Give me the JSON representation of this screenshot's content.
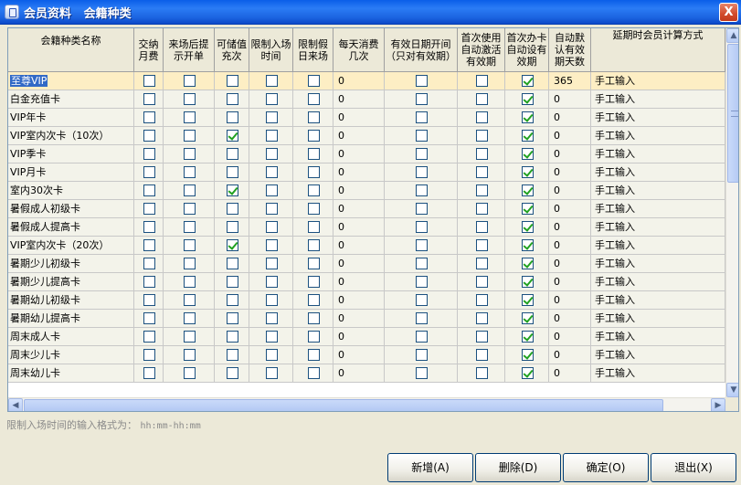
{
  "window": {
    "title": "会员资料   会籍种类",
    "close_label": "X"
  },
  "columns": [
    "会籍种类名称",
    "交纳月费",
    "来场后提示开单",
    "可储值充次",
    "限制入场时间",
    "限制假日来场",
    "每天消费几次",
    "有效日期开间（只对有效期）",
    "首次使用自动激活有效期",
    "首次办卡自动设有效期",
    "自动默认有效期天数",
    "延期时会员计算方式"
  ],
  "rows": [
    {
      "name": "至尊VIP",
      "flags": [
        false,
        false,
        false,
        false,
        false
      ],
      "times": "0",
      "d1": false,
      "d2": false,
      "d3": true,
      "days": "365",
      "ext": "手工输入"
    },
    {
      "name": "白金充值卡",
      "flags": [
        false,
        false,
        false,
        false,
        false
      ],
      "times": "0",
      "d1": false,
      "d2": false,
      "d3": true,
      "days": "0",
      "ext": "手工输入"
    },
    {
      "name": "VIP年卡",
      "flags": [
        false,
        false,
        false,
        false,
        false
      ],
      "times": "0",
      "d1": false,
      "d2": false,
      "d3": true,
      "days": "0",
      "ext": "手工输入"
    },
    {
      "name": "VIP室内次卡（10次）",
      "flags": [
        false,
        false,
        true,
        false,
        false
      ],
      "times": "0",
      "d1": false,
      "d2": false,
      "d3": true,
      "days": "0",
      "ext": "手工输入"
    },
    {
      "name": "VIP季卡",
      "flags": [
        false,
        false,
        false,
        false,
        false
      ],
      "times": "0",
      "d1": false,
      "d2": false,
      "d3": true,
      "days": "0",
      "ext": "手工输入"
    },
    {
      "name": "VIP月卡",
      "flags": [
        false,
        false,
        false,
        false,
        false
      ],
      "times": "0",
      "d1": false,
      "d2": false,
      "d3": true,
      "days": "0",
      "ext": "手工输入"
    },
    {
      "name": "室内30次卡",
      "flags": [
        false,
        false,
        true,
        false,
        false
      ],
      "times": "0",
      "d1": false,
      "d2": false,
      "d3": true,
      "days": "0",
      "ext": "手工输入"
    },
    {
      "name": "暑假成人初级卡",
      "flags": [
        false,
        false,
        false,
        false,
        false
      ],
      "times": "0",
      "d1": false,
      "d2": false,
      "d3": true,
      "days": "0",
      "ext": "手工输入"
    },
    {
      "name": "暑假成人提高卡",
      "flags": [
        false,
        false,
        false,
        false,
        false
      ],
      "times": "0",
      "d1": false,
      "d2": false,
      "d3": true,
      "days": "0",
      "ext": "手工输入"
    },
    {
      "name": "VIP室内次卡（20次）",
      "flags": [
        false,
        false,
        true,
        false,
        false
      ],
      "times": "0",
      "d1": false,
      "d2": false,
      "d3": true,
      "days": "0",
      "ext": "手工输入"
    },
    {
      "name": "暑期少儿初级卡",
      "flags": [
        false,
        false,
        false,
        false,
        false
      ],
      "times": "0",
      "d1": false,
      "d2": false,
      "d3": true,
      "days": "0",
      "ext": "手工输入"
    },
    {
      "name": "暑期少儿提高卡",
      "flags": [
        false,
        false,
        false,
        false,
        false
      ],
      "times": "0",
      "d1": false,
      "d2": false,
      "d3": true,
      "days": "0",
      "ext": "手工输入"
    },
    {
      "name": "暑期幼儿初级卡",
      "flags": [
        false,
        false,
        false,
        false,
        false
      ],
      "times": "0",
      "d1": false,
      "d2": false,
      "d3": true,
      "days": "0",
      "ext": "手工输入"
    },
    {
      "name": "暑期幼儿提高卡",
      "flags": [
        false,
        false,
        false,
        false,
        false
      ],
      "times": "0",
      "d1": false,
      "d2": false,
      "d3": true,
      "days": "0",
      "ext": "手工输入"
    },
    {
      "name": "周末成人卡",
      "flags": [
        false,
        false,
        false,
        false,
        false
      ],
      "times": "0",
      "d1": false,
      "d2": false,
      "d3": true,
      "days": "0",
      "ext": "手工输入"
    },
    {
      "name": "周末少儿卡",
      "flags": [
        false,
        false,
        false,
        false,
        false
      ],
      "times": "0",
      "d1": false,
      "d2": false,
      "d3": true,
      "days": "0",
      "ext": "手工输入"
    },
    {
      "name": "周末幼儿卡",
      "flags": [
        false,
        false,
        false,
        false,
        false
      ],
      "times": "0",
      "d1": false,
      "d2": false,
      "d3": true,
      "days": "0",
      "ext": "手工输入"
    }
  ],
  "selected_row": 0,
  "hint": {
    "label": "限制入场时间的输入格式为：",
    "format": "hh:mm-hh:mm"
  },
  "buttons": {
    "add": "新增(A)",
    "delete": "删除(D)",
    "ok": "确定(O)",
    "exit": "退出(X)"
  },
  "icons": {
    "scroll_up": "▲",
    "scroll_down": "▼",
    "scroll_left": "◀",
    "scroll_right": "▶"
  }
}
